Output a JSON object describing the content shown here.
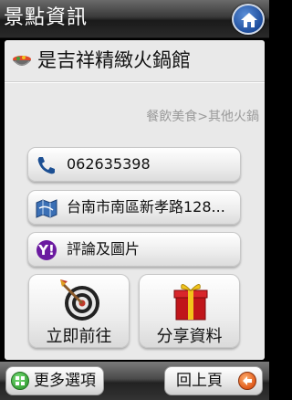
{
  "header": {
    "title": "景點資訊",
    "home_icon": "home-icon"
  },
  "place": {
    "name": "是吉祥精緻火鍋館",
    "category": "餐飲美食>其他火鍋"
  },
  "actions": {
    "phone": "062635398",
    "address": "台南市南區新孝路128...",
    "reviews": "評論及圖片",
    "go": "立即前往",
    "share": "分享資料"
  },
  "footer": {
    "more": "更多選項",
    "back": "回上頁"
  },
  "colors": {
    "home_blue": "#1e4d9c",
    "more_green": "#3aa53a",
    "back_orange": "#e05a1a"
  }
}
